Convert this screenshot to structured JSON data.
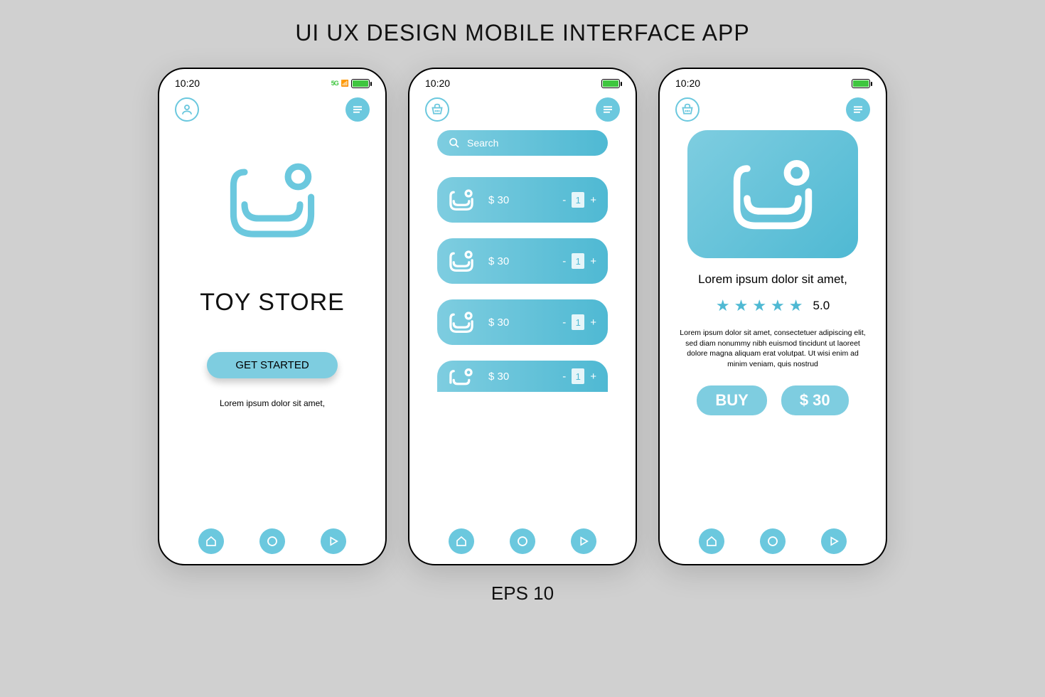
{
  "page": {
    "title": "UI UX DESIGN MOBILE INTERFACE APP",
    "footer": "EPS 10"
  },
  "status": {
    "time": "10:20",
    "signal": "5G"
  },
  "colors": {
    "accent": "#6bc8de",
    "accent_dark": "#4fb9d3"
  },
  "screen1": {
    "title": "TOY STORE",
    "cta": "GET STARTED",
    "sub": "Lorem ipsum dolor sit amet,"
  },
  "screen2": {
    "search_placeholder": "Search",
    "items": [
      {
        "price": "$ 30",
        "qty": "1"
      },
      {
        "price": "$ 30",
        "qty": "1"
      },
      {
        "price": "$ 30",
        "qty": "1"
      },
      {
        "price": "$ 30",
        "qty": "1"
      }
    ]
  },
  "screen3": {
    "title": "Lorem ipsum dolor sit amet,",
    "rating": "5.0",
    "description": "Lorem ipsum dolor sit amet, consectetuer adipiscing elit, sed diam nonummy nibh euismod tincidunt ut laoreet dolore magna aliquam erat volutpat. Ut wisi enim ad minim veniam, quis nostrud",
    "buy": "BUY",
    "price": "$ 30"
  }
}
